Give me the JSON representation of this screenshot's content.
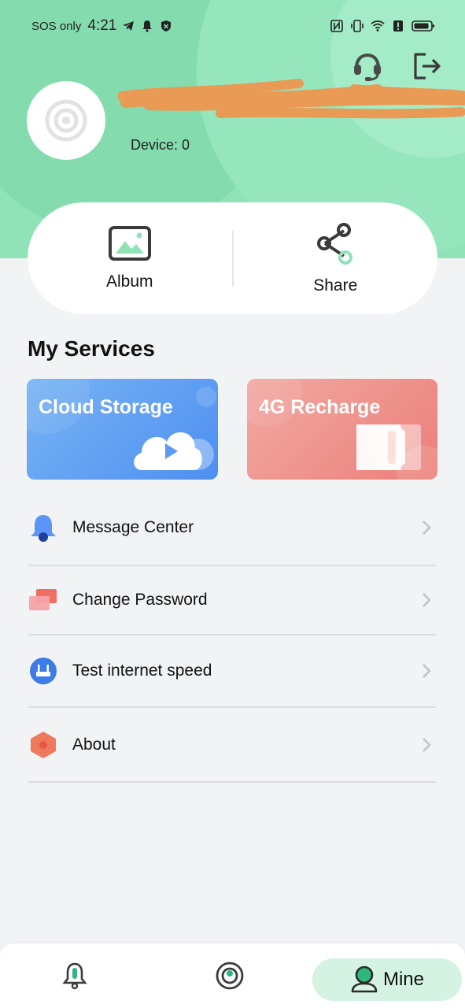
{
  "status_bar": {
    "carrier": "SOS only",
    "time": "4:21",
    "icons_left": [
      "telegram-icon",
      "bell-icon",
      "shield-icon"
    ],
    "icons_right": [
      "nfc-icon",
      "vibrate-icon",
      "wifi-icon",
      "alert-icon",
      "battery-icon"
    ]
  },
  "header": {
    "support_icon": "headset-icon",
    "logout_icon": "logout-icon",
    "device_count_label": "Device: 0",
    "username_redacted": true
  },
  "quick_actions": [
    {
      "label": "Album",
      "icon": "image-icon"
    },
    {
      "label": "Share",
      "icon": "share-icon"
    }
  ],
  "services": {
    "title": "My Services",
    "cards": [
      {
        "label": "Cloud Storage",
        "icon": "cloud-play-icon",
        "color": "#5b9bf2"
      },
      {
        "label": "4G Recharge",
        "icon": "sim-card-icon",
        "color": "#ee8a84"
      }
    ]
  },
  "menu": [
    {
      "label": "Message Center",
      "icon": "bell-icon"
    },
    {
      "label": "Change Password",
      "icon": "cards-icon"
    },
    {
      "label": "Test internet speed",
      "icon": "router-icon"
    },
    {
      "label": "About",
      "icon": "hexagon-icon"
    }
  ],
  "bottom_nav": [
    {
      "label": "",
      "icon": "alarm-bell-icon",
      "active": false
    },
    {
      "label": "",
      "icon": "camera-lens-icon",
      "active": false
    },
    {
      "label": "Mine",
      "icon": "user-icon",
      "active": true
    }
  ],
  "colors": {
    "header_green": "#8fe3b6",
    "accent_green": "#2fb67a",
    "background": "#f2f3f5",
    "nav_active": "#d4f3e2"
  }
}
